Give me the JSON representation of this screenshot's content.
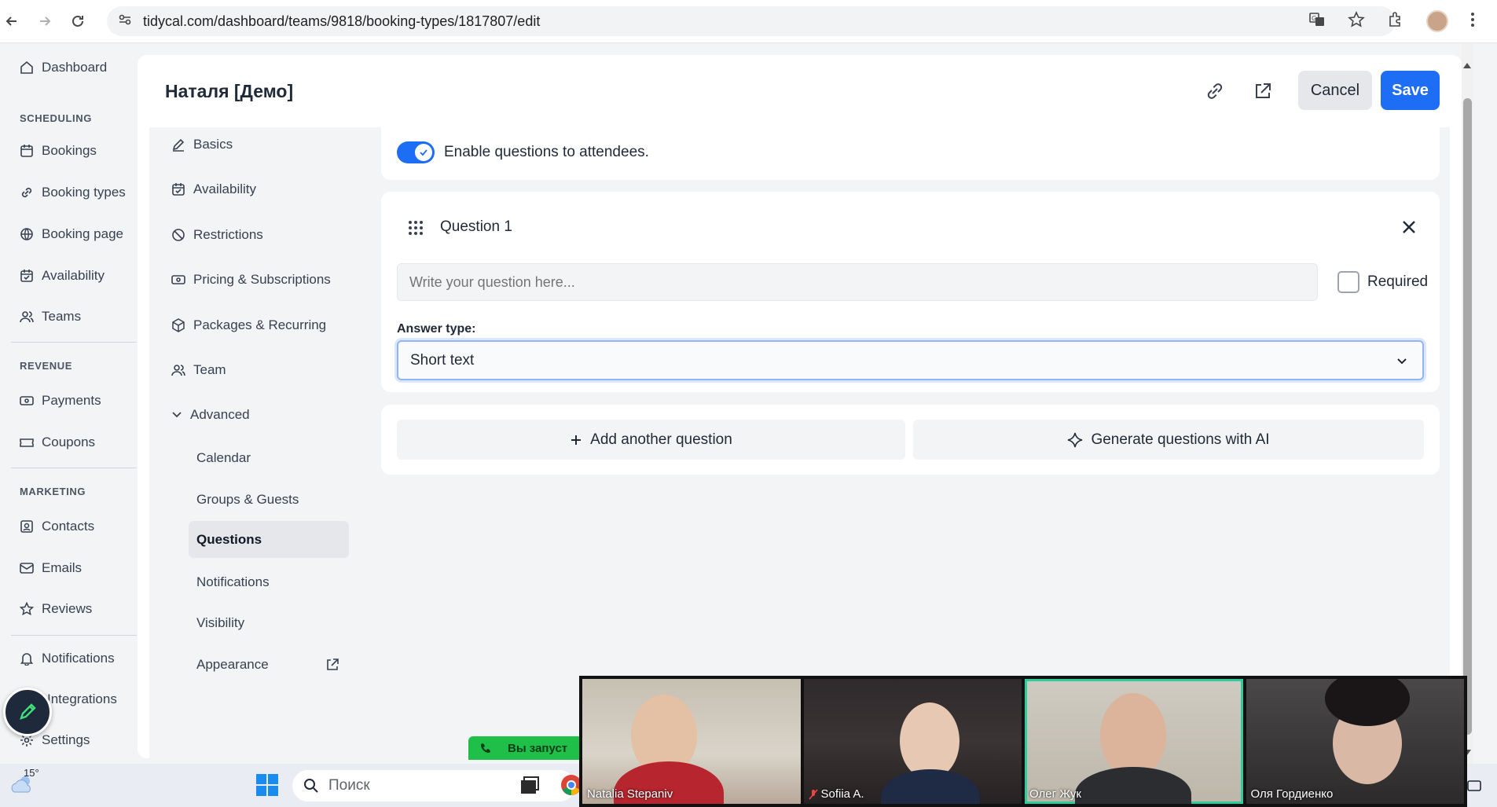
{
  "browser": {
    "url": "tidycal.com/dashboard/teams/9818/booking-types/1817807/edit"
  },
  "sidebar": {
    "items_top": [
      {
        "label": "Dashboard",
        "icon": "home-icon"
      }
    ],
    "scheduling_heading": "SCHEDULING",
    "scheduling_items": [
      {
        "label": "Bookings",
        "icon": "calendar-icon"
      },
      {
        "label": "Booking types",
        "icon": "link-icon"
      },
      {
        "label": "Booking page",
        "icon": "globe-icon"
      },
      {
        "label": "Availability",
        "icon": "calendar-check-icon"
      },
      {
        "label": "Teams",
        "icon": "users-icon"
      }
    ],
    "revenue_heading": "REVENUE",
    "revenue_items": [
      {
        "label": "Payments",
        "icon": "money-icon"
      },
      {
        "label": "Coupons",
        "icon": "ticket-icon"
      }
    ],
    "marketing_heading": "MARKETING",
    "marketing_items": [
      {
        "label": "Contacts",
        "icon": "contact-icon"
      },
      {
        "label": "Emails",
        "icon": "mail-icon"
      },
      {
        "label": "Reviews",
        "icon": "star-icon"
      }
    ],
    "bottom_items": [
      {
        "label": "Notifications",
        "icon": "bell-icon"
      },
      {
        "label": "Integrations",
        "icon": "puzzle-icon"
      },
      {
        "label": "Settings",
        "icon": "gear-icon"
      }
    ]
  },
  "modal": {
    "title": "Наталя [Демо]",
    "cancel_label": "Cancel",
    "save_label": "Save"
  },
  "subnav": {
    "items": [
      {
        "label": "Basics",
        "icon": "edit-icon"
      },
      {
        "label": "Availability",
        "icon": "calendar-check-icon"
      },
      {
        "label": "Restrictions",
        "icon": "ban-icon"
      },
      {
        "label": "Pricing & Subscriptions",
        "icon": "money-icon"
      },
      {
        "label": "Packages & Recurring",
        "icon": "package-icon"
      },
      {
        "label": "Team",
        "icon": "users-icon"
      }
    ],
    "advanced_label": "Advanced",
    "advanced_children": [
      {
        "label": "Calendar"
      },
      {
        "label": "Groups & Guests"
      },
      {
        "label": "Questions",
        "active": true
      },
      {
        "label": "Notifications"
      },
      {
        "label": "Visibility"
      },
      {
        "label": "Appearance"
      }
    ]
  },
  "questions": {
    "enable_label": "Enable questions to attendees.",
    "enabled": true,
    "question_title": "Question 1",
    "question_placeholder": "Write your question here...",
    "required_label": "Required",
    "answer_type_label": "Answer type:",
    "answer_type_value": "Short text",
    "add_question_label": "Add another question",
    "generate_ai_label": "Generate questions with AI"
  },
  "taskbar": {
    "weather": "15°",
    "search_placeholder": "Поиск",
    "banner_text": "Вы запуст"
  },
  "video_call": {
    "participants": [
      {
        "name": "Natalia Stepaniv",
        "muted": false
      },
      {
        "name": "Sofiia A.",
        "muted": true
      },
      {
        "name": "Олег Жук",
        "muted": false,
        "active": true
      },
      {
        "name": "Оля Гордиенко",
        "muted": false
      }
    ]
  },
  "colors": {
    "accent": "#1e6ef5",
    "background": "#f3f4f6",
    "active_speaker": "#2ecc9a"
  }
}
